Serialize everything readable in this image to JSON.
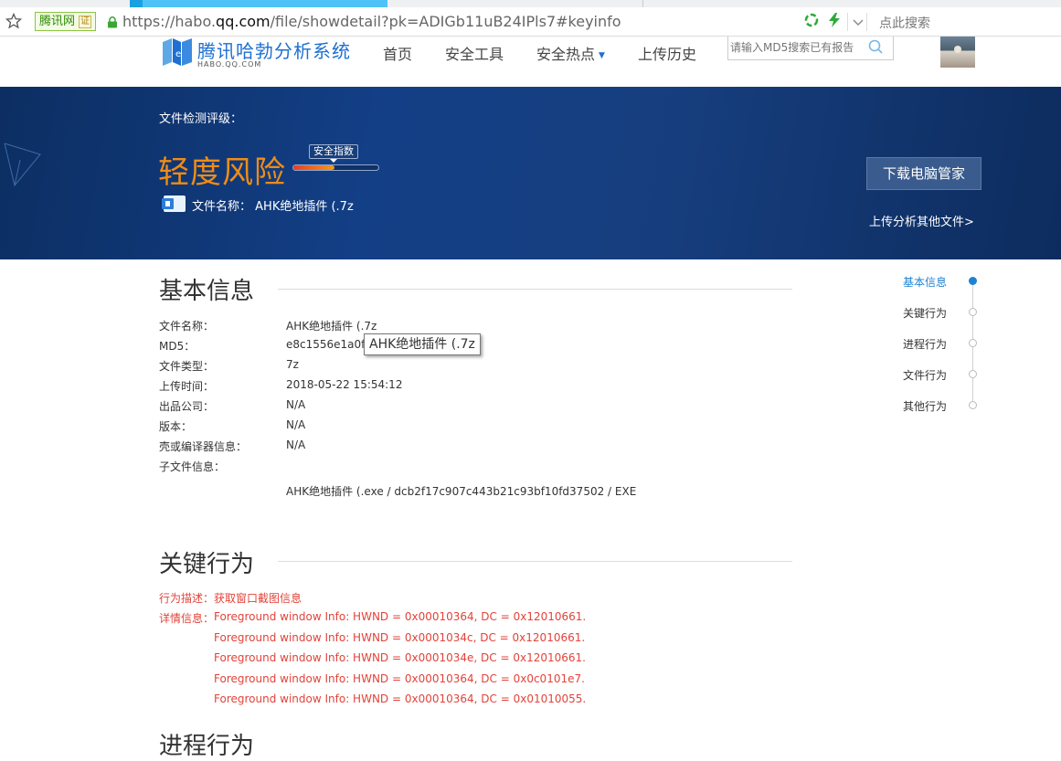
{
  "browser": {
    "verify_label": "腾讯网",
    "verify_badge": "证",
    "url_scheme": "https://habo.",
    "url_host": "qq.com",
    "url_path": "/file/showdetail?pk=ADIGb11uB24IPls7#keyinfo",
    "search_placeholder": "点此搜索"
  },
  "header": {
    "logo_title": "腾讯哈勃分析系统",
    "logo_subtitle": "HABO.QQ.COM",
    "nav": [
      "首页",
      "安全工具",
      "安全热点",
      "上传历史"
    ],
    "search_placeholder": "请输入MD5搜索已有报告"
  },
  "hero": {
    "label": "文件检测评级：",
    "risk_level": "轻度风险",
    "gauge_label": "安全指数",
    "gauge_level": 0.48,
    "file_name_label": "文件名称：",
    "file_name": "AHK绝地插件 (.7z",
    "download_button": "下载电脑管家",
    "upload_link": "上传分析其他文件>"
  },
  "basic": {
    "title": "基本信息",
    "rows": [
      {
        "label": "文件名称：",
        "value": "AHK绝地插件 (.7z"
      },
      {
        "label": "MD5：",
        "value": "e8c1556e1a0fe"
      },
      {
        "label": "文件类型：",
        "value": "7z"
      },
      {
        "label": "上传时间：",
        "value": "2018-05-22 15:54:12"
      },
      {
        "label": "出品公司：",
        "value": "N/A"
      },
      {
        "label": "版本：",
        "value": "N/A"
      },
      {
        "label": "壳或编译器信息：",
        "value": "N/A"
      },
      {
        "label": "子文件信息：",
        "value": ""
      }
    ],
    "subfile": "AHK绝地插件 (.exe /  dcb2f17c907c443b21c93bf10fd37502 /  EXE",
    "tooltip": "AHK绝地插件 (.7z"
  },
  "key_behavior": {
    "title": "关键行为",
    "desc_label": "行为描述：",
    "desc_value": "获取窗口截图信息",
    "detail_label": "详情信息：",
    "details": [
      "Foreground window Info: HWND = 0x00010364, DC = 0x12010661.",
      "Foreground window Info: HWND = 0x0001034c, DC = 0x12010661.",
      "Foreground window Info: HWND = 0x0001034e, DC = 0x12010661.",
      "Foreground window Info: HWND = 0x00010364, DC = 0x0c0101e7.",
      "Foreground window Info: HWND = 0x00010364, DC = 0x01010055."
    ]
  },
  "next_section_title": "进程行为",
  "side_nav": [
    "基本信息",
    "关键行为",
    "进程行为",
    "文件行为",
    "其他行为"
  ],
  "colors": {
    "accent": "#1e82d2",
    "risk": "#f08c16",
    "hero_bg": "#133f86",
    "alert": "#e2433a"
  }
}
